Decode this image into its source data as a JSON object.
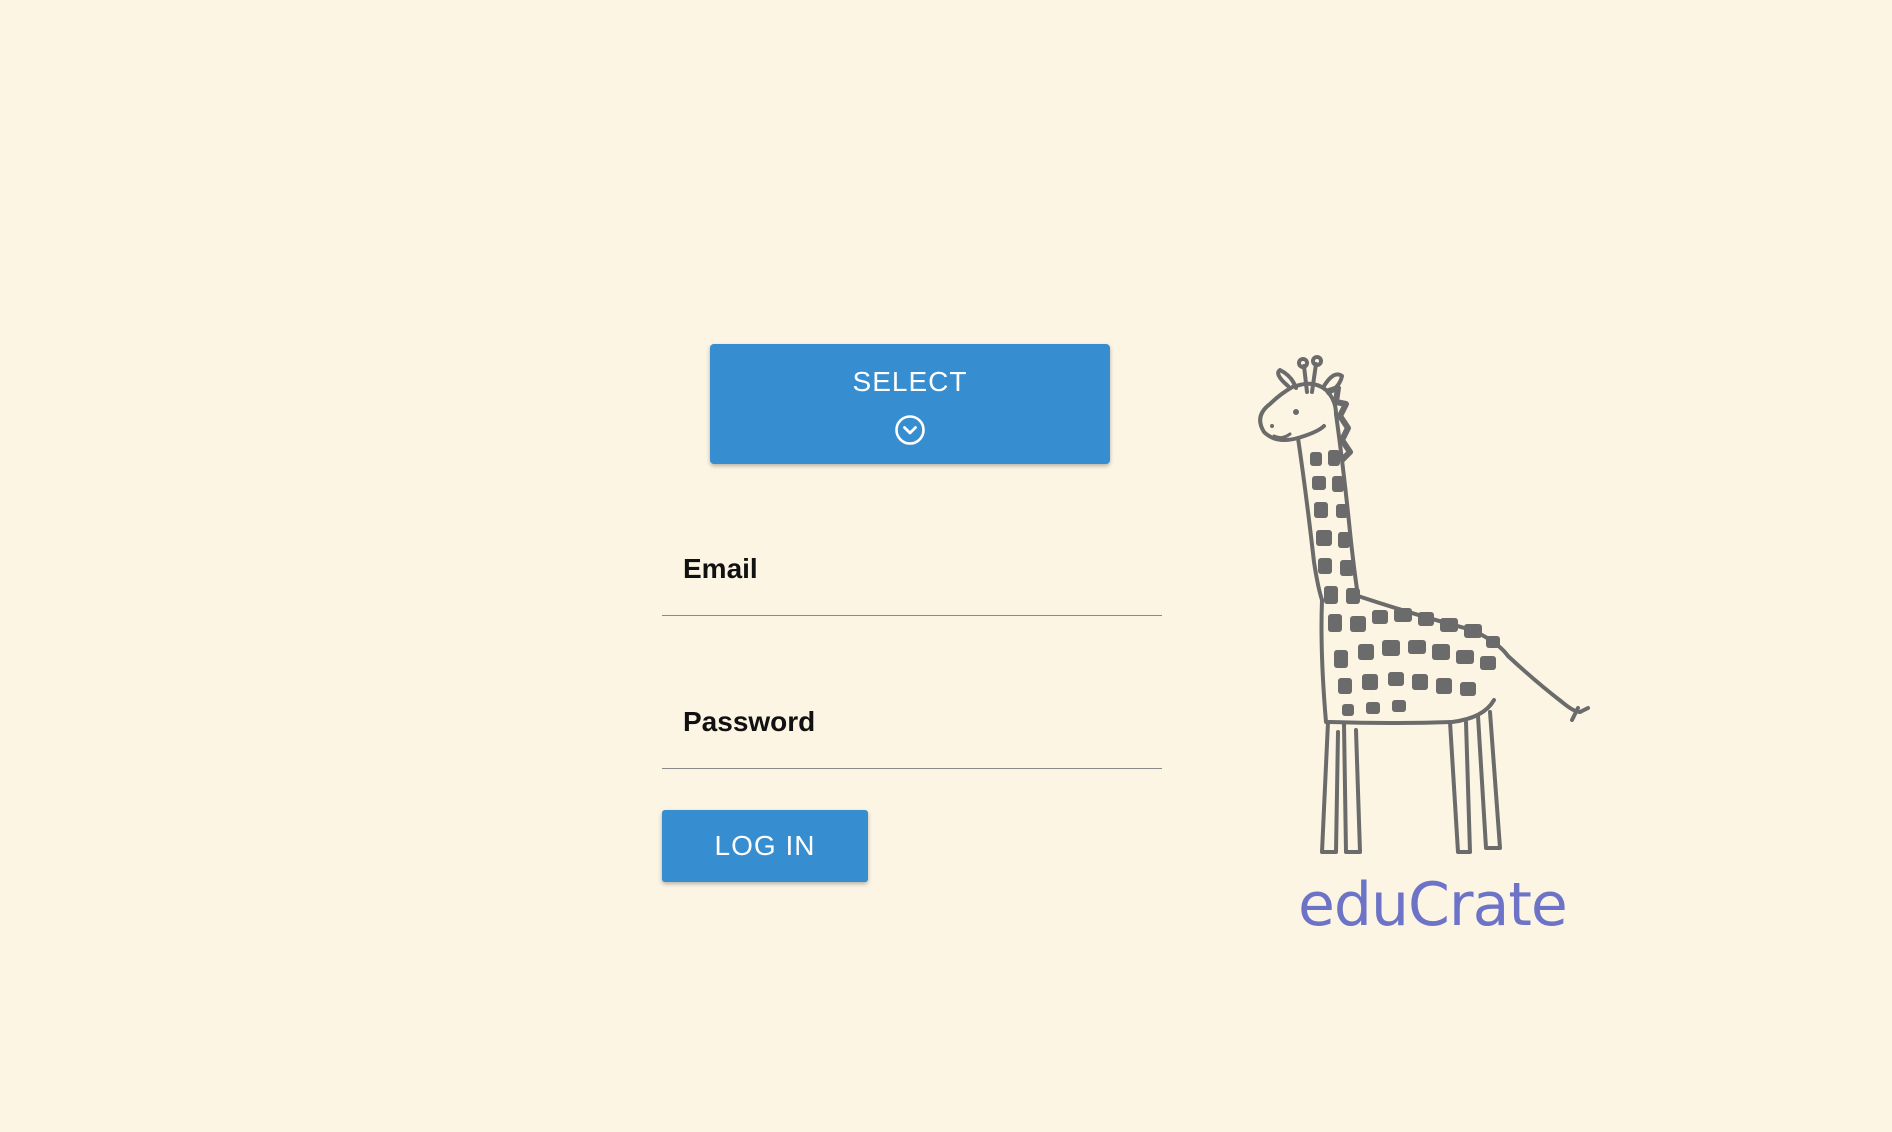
{
  "select_button": {
    "label": "SELECT",
    "icon": "chevron-down-circle-icon"
  },
  "form": {
    "email_label": "Email",
    "email_value": "",
    "password_label": "Password",
    "password_value": "",
    "login_label": "LOG IN"
  },
  "brand": {
    "logo_icon": "giraffe-icon",
    "name": "eduCrate"
  },
  "colors": {
    "background": "#fdf5e4",
    "primary": "#368dd0",
    "button_text": "#ffffff",
    "brand_text": "#6d74c8",
    "illustration": "#6b6b6b"
  }
}
